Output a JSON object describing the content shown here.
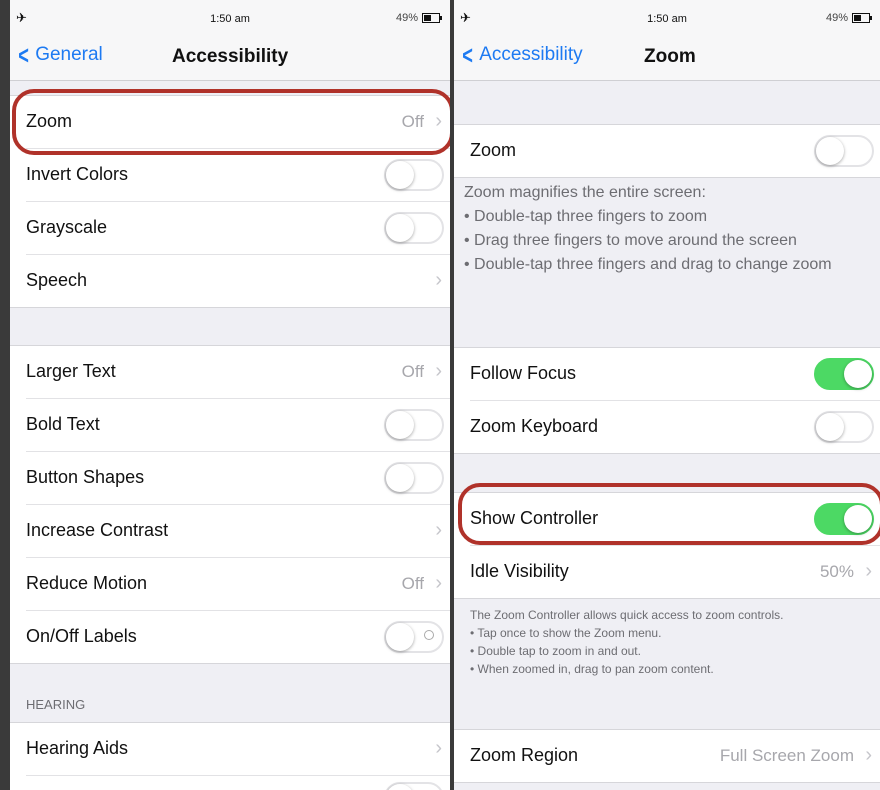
{
  "left": {
    "status": {
      "time": "1:50 am",
      "battery": "49%"
    },
    "nav": {
      "back": "General",
      "title": "Accessibility"
    },
    "group1": [
      {
        "label": "Zoom",
        "value": "Off",
        "type": "link"
      },
      {
        "label": "Invert Colors",
        "type": "toggle",
        "on": false
      },
      {
        "label": "Grayscale",
        "type": "toggle",
        "on": false
      },
      {
        "label": "Speech",
        "type": "link"
      }
    ],
    "group2": [
      {
        "label": "Larger Text",
        "value": "Off",
        "type": "link"
      },
      {
        "label": "Bold Text",
        "type": "toggle",
        "on": false
      },
      {
        "label": "Button Shapes",
        "type": "toggle",
        "on": false
      },
      {
        "label": "Increase Contrast",
        "type": "link"
      },
      {
        "label": "Reduce Motion",
        "value": "Off",
        "type": "link"
      },
      {
        "label": "On/Off Labels",
        "type": "toggle",
        "on": false
      }
    ],
    "hearing_header": "HEARING",
    "group3": [
      {
        "label": "Hearing Aids",
        "type": "link"
      }
    ]
  },
  "right": {
    "status": {
      "time": "1:50 am",
      "battery": "49%"
    },
    "nav": {
      "back": "Accessibility",
      "title": "Zoom"
    },
    "zoom_row": {
      "label": "Zoom",
      "on": false
    },
    "zoom_desc": [
      "Zoom magnifies the entire screen:",
      "• Double-tap three fingers to zoom",
      "• Drag three fingers to move around the screen",
      "• Double-tap three fingers and drag to change zoom"
    ],
    "group2": [
      {
        "label": "Follow Focus",
        "on": true
      },
      {
        "label": "Zoom Keyboard",
        "on": false
      }
    ],
    "group3": [
      {
        "label": "Show Controller",
        "type": "toggle",
        "on": true
      },
      {
        "label": "Idle Visibility",
        "value": "50%",
        "type": "link"
      }
    ],
    "controller_desc": [
      "The Zoom Controller allows quick access to zoom controls.",
      "• Tap once to show the Zoom menu.",
      "• Double tap to zoom in and out.",
      "• When zoomed in, drag to pan zoom content."
    ],
    "region_row": {
      "label": "Zoom Region",
      "value": "Full Screen Zoom"
    }
  },
  "colors": {
    "accent": "#1d7af2",
    "toggle_on": "#4cd964",
    "highlight": "#b0322a"
  }
}
